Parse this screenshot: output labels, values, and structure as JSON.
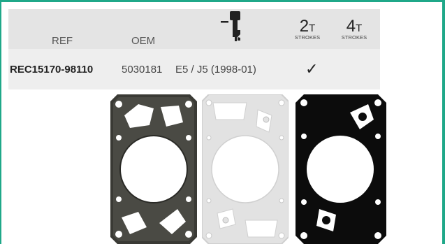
{
  "table": {
    "headers": {
      "ref": "REF",
      "oem": "OEM",
      "engine_icon": "outboard-motor-icon",
      "stroke_2": {
        "number": "2",
        "letter": "T",
        "label": "STROKES"
      },
      "stroke_4": {
        "number": "4",
        "letter": "T",
        "label": "STROKES"
      }
    },
    "row": {
      "ref": "REC15170-98110",
      "oem": "5030181",
      "application": "E5 / J5 (1998-01)",
      "two_stroke": "✓",
      "four_stroke": ""
    }
  },
  "images": {
    "gasket_1": "gasket-dark-icon",
    "gasket_2": "gasket-light-icon",
    "gasket_3": "gasket-black-icon"
  },
  "colors": {
    "accent": "#1fa889",
    "header_bg": "#e4e4e4",
    "row_bg": "#eeeeee"
  }
}
